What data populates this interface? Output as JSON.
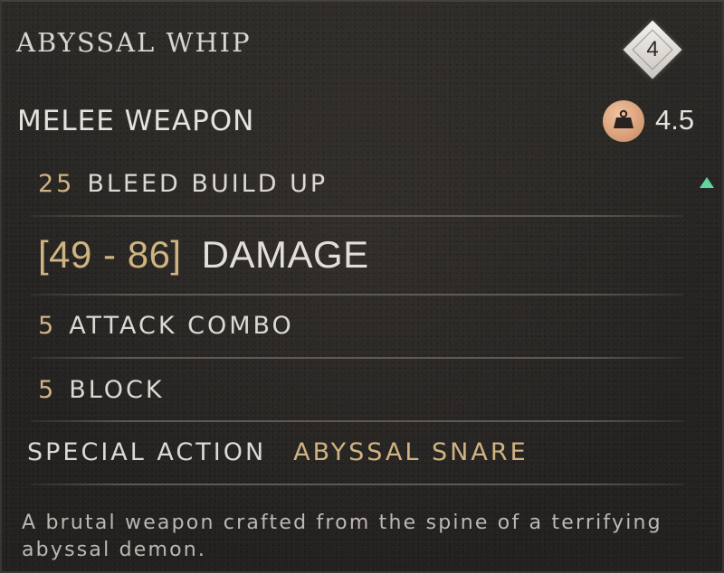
{
  "item": {
    "name": "ABYSSAL WHIP",
    "tier": "4",
    "type": "MELEE WEAPON",
    "weight": "4.5"
  },
  "stats": {
    "bleed": {
      "value": "25",
      "label": "BLEED BUILD UP",
      "indicator": "up-arrow-icon"
    },
    "damage": {
      "value": "[49 - 86]",
      "label": "DAMAGE"
    },
    "attack_combo": {
      "value": "5",
      "label": "ATTACK COMBO"
    },
    "block": {
      "value": "5",
      "label": "BLOCK"
    }
  },
  "special_action": {
    "label": "SPECIAL ACTION",
    "value": "ABYSSAL SNARE"
  },
  "description": "A brutal weapon crafted from the spine of a terrifying abyssal demon.",
  "colors": {
    "accent_gold": "#cfb381",
    "text": "#dcd8d2",
    "increase_green": "#5fd6a0",
    "weight_icon": "#d49a72"
  }
}
